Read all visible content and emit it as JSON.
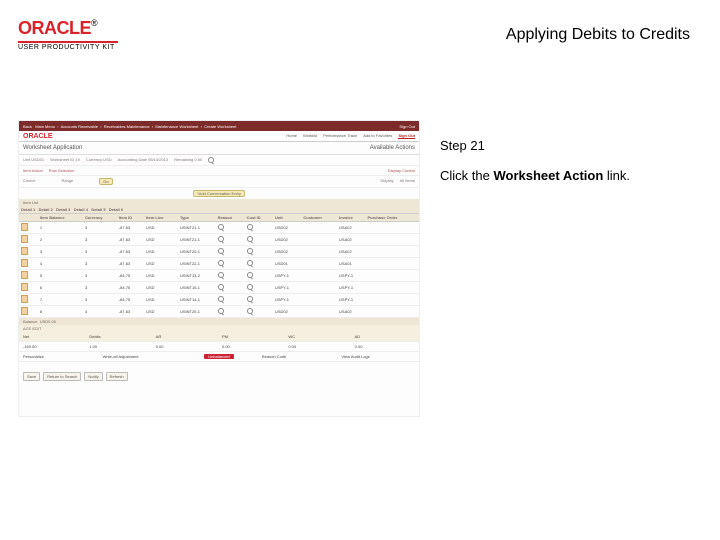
{
  "header": {
    "logo_word": "ORACLE",
    "logo_reg": "®",
    "logo_sub": "USER PRODUCTIVITY KIT",
    "title": "Applying Debits to Credits"
  },
  "guidance": {
    "step_label": "Step 21",
    "text_before": "Click the ",
    "link_text": "Worksheet Action",
    "text_after": " link."
  },
  "shot": {
    "browser_tabs": [
      "Back",
      "Main Menu",
      "Accounts Receivable",
      "Receivables Maintenance",
      "Maintenance Worksheet",
      "Create Worksheet"
    ],
    "signin": "Sign Out",
    "brand": "ORACLE",
    "top_tabs": [
      "Home",
      "Worklist",
      "Performance Trace",
      "Add to Favorites",
      "Sign Out"
    ],
    "page_title": "Worksheet Application",
    "available_label": "Available Actions",
    "filters1": {
      "unit": "Unit  USD01",
      "wsid": "Worksheet ID  19",
      "currency": "Currency  USD",
      "acctdate": "Accounting Date  05/14/2013",
      "remaining": "Remaining  0.00"
    },
    "item_action": "Item Action",
    "row_sel": "Row Selection",
    "display_ctrl": "Display Control",
    "choice": "Choice",
    "range": "Range",
    "go": "Go",
    "display": "Display",
    "allitems": "All Items",
    "item_list": "Item List",
    "add_conv": "*Add Conversation Entry",
    "columns": [
      "Detail 1",
      "Detail 2",
      "Detail 3",
      "Detail 4",
      "Detail 5",
      "Detail 6"
    ],
    "headers": [
      "",
      "Item Balance",
      "Currency",
      "Item ID",
      "Item Line",
      "Type",
      "Reason",
      "Cust ID",
      "Unit",
      "Customer",
      "Invoice",
      "Purchase Order"
    ],
    "rows": [
      [
        "1",
        "3",
        "-87.63",
        "USD",
        "USINT21-1",
        "",
        "",
        "1",
        "",
        "USD02",
        "",
        "USA02",
        ""
      ],
      [
        "2",
        "3",
        "",
        "-87.63",
        "USD",
        "USINT21-1",
        "",
        "",
        "1",
        "",
        "USD02",
        "",
        "USA02",
        ""
      ],
      [
        "3",
        "3",
        "",
        "-87.63",
        "USD",
        "USINT20-1",
        "",
        "",
        "1",
        "",
        "USD02",
        "",
        "USA02",
        ""
      ],
      [
        "4",
        "3",
        "",
        "-87.63",
        "USD",
        "USINT22-1",
        "",
        "",
        "1",
        "",
        "USD01",
        "",
        "USA01",
        ""
      ],
      [
        "5",
        "3",
        "",
        "-84.75",
        "USD",
        "USINT13-2",
        "",
        "",
        "1",
        "",
        "USPY-1",
        "",
        "USPY-1",
        ""
      ],
      [
        "6",
        "3",
        "",
        "-84.75",
        "USD",
        "USINT15-1",
        "",
        "",
        "1",
        "",
        "USPY-1",
        "",
        "USPY-1",
        ""
      ],
      [
        "7",
        "3",
        "",
        "-84.75",
        "USD",
        "USINT14-1",
        "",
        "",
        "1",
        "",
        "USPY-1",
        "",
        "USPY-1",
        ""
      ],
      [
        "8",
        "4",
        "",
        "-87.63",
        "USD",
        "USINT20-1",
        "",
        "",
        "1",
        "",
        "USD02",
        "",
        "USA02",
        ""
      ]
    ],
    "balance_hdr": "Balance",
    "balance_val": "USD0.00",
    "bal_cols": [
      "Net",
      "Debits",
      "AR",
      "PM",
      "WC",
      "AD"
    ],
    "bal_vals": [
      "-169.50",
      "1.00",
      "0.00",
      "0.00",
      "0.00",
      "0.00"
    ],
    "legends": [
      "Personalize",
      "Write-off Adjustment",
      "",
      "Reason Code",
      "View Audit Logs"
    ],
    "btn_status": "Unbalanced",
    "bottom_btns": [
      "Save",
      "Return to Search",
      "Notify",
      "Refresh"
    ]
  }
}
